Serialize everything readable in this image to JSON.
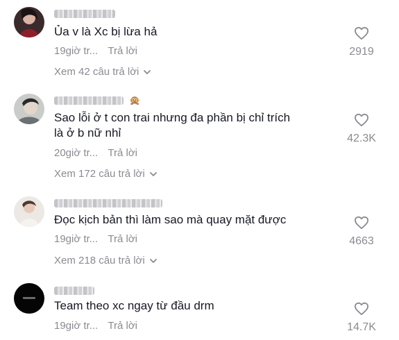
{
  "comments": [
    {
      "text": "Ủa v là Xc bị lừa hả",
      "time": "19giờ tr...",
      "reply": "Trả lời",
      "view_replies": "Xem 42 câu trả lời",
      "likes": "2919"
    },
    {
      "text": "Sao lỗi ở t     con trai nhưng đa phần bị chỉ trích\nlà ở b nữ nhỉ",
      "time": "20giờ tr...",
      "reply": "Trả lời",
      "view_replies": "Xem 172 câu trả lời",
      "likes": "42.3K",
      "username_emoji": "🙊"
    },
    {
      "text": "Đọc kịch bản thì làm sao mà quay mặt được",
      "time": "19giờ tr...",
      "reply": "Trả lời",
      "view_replies": "Xem 218 câu trả lời",
      "likes": "4663"
    },
    {
      "text": "Team theo xc ngay từ đầu drm",
      "time": "19giờ tr...",
      "reply": "Trả lời",
      "likes": "14.7K"
    }
  ],
  "icons": {
    "like": "heart-outline-icon",
    "expand": "chevron-down-icon"
  },
  "colors": {
    "text_primary": "#161823",
    "text_secondary": "#8a8b91"
  }
}
